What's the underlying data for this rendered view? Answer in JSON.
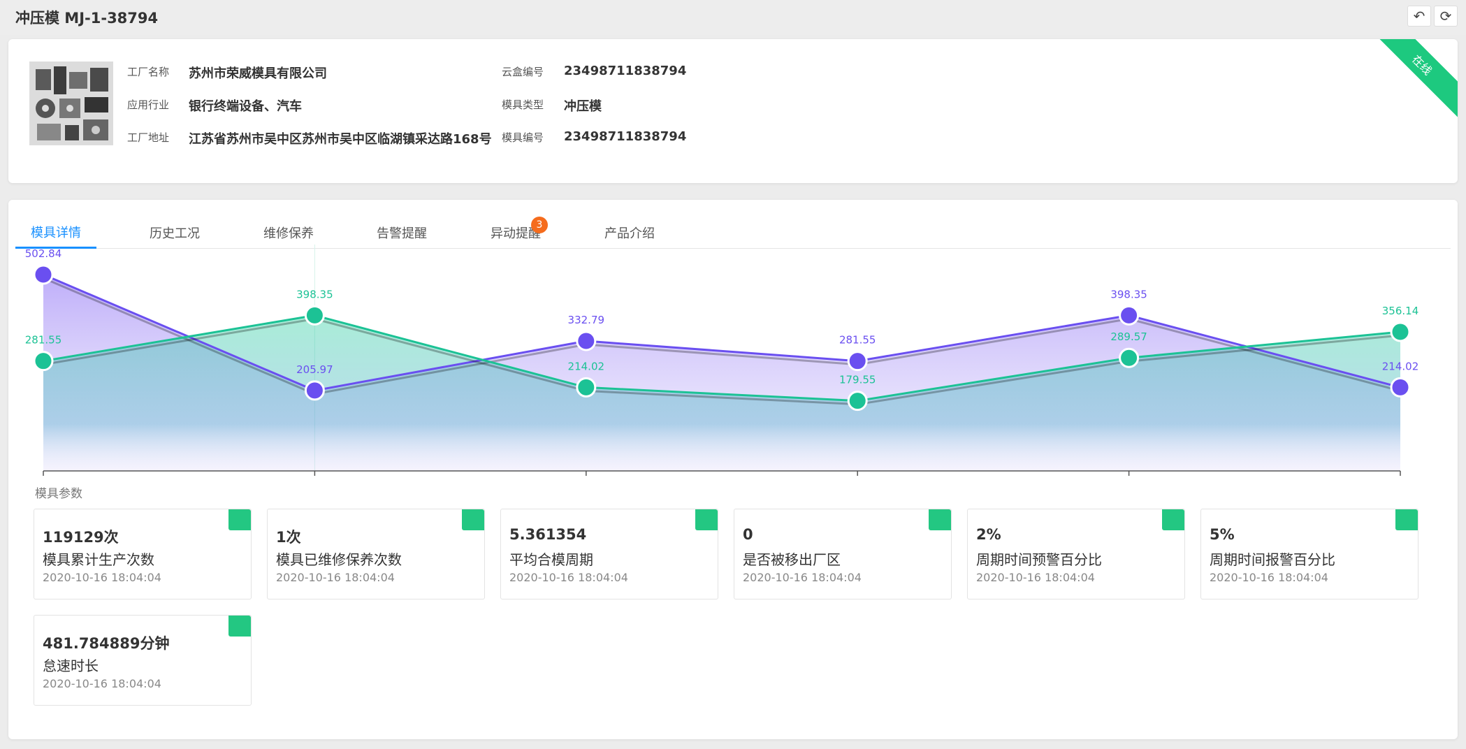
{
  "header": {
    "title": "冲压模 MJ-1-38794",
    "back_icon": "undo-icon",
    "refresh_icon": "refresh-icon"
  },
  "info": {
    "factory_name_label": "工厂名称",
    "factory_name": "苏州市荣威模具有限公司",
    "industry_label": "应用行业",
    "industry": "银行终端设备、汽车",
    "address_label": "工厂地址",
    "address": "江苏省苏州市吴中区苏州市吴中区临湖镇采达路168号",
    "box_no_label": "云盒编号",
    "box_no": "23498711838794",
    "mold_type_label": "模具类型",
    "mold_type": "冲压模",
    "mold_no_label": "模具编号",
    "mold_no": "23498711838794",
    "status": "在线",
    "status_color": "#1dc97f"
  },
  "tabs": [
    {
      "label": "模具详情",
      "active": true
    },
    {
      "label": "历史工况"
    },
    {
      "label": "维修保养"
    },
    {
      "label": "告警提醒"
    },
    {
      "label": "异动提醒",
      "badge": "3"
    },
    {
      "label": "产品介绍"
    }
  ],
  "chart_data": {
    "type": "area",
    "x": [
      "",
      "",
      "",
      "",
      "",
      ""
    ],
    "series": [
      {
        "color": "#6a4ff0",
        "values": [
          502.84,
          205.97,
          332.79,
          281.55,
          398.35,
          214.02
        ]
      },
      {
        "color": "#1cc295",
        "values": [
          281.55,
          398.35,
          214.02,
          179.55,
          289.57,
          356.14
        ]
      }
    ],
    "ylim": [
      0,
      560
    ],
    "xlabel": "",
    "ylabel": "",
    "grid": false
  },
  "params_section_label": "模具参数",
  "params": [
    {
      "value": "119129次",
      "name": "模具累计生产次数",
      "time": "2020-10-16 18:04:04"
    },
    {
      "value": "1次",
      "name": "模具已维修保养次数",
      "time": "2020-10-16 18:04:04"
    },
    {
      "value": "5.361354",
      "name": "平均合模周期",
      "time": "2020-10-16 18:04:04"
    },
    {
      "value": "0",
      "name": "是否被移出厂区",
      "time": "2020-10-16 18:04:04"
    },
    {
      "value": "2%",
      "name": "周期时间预警百分比",
      "time": "2020-10-16 18:04:04"
    },
    {
      "value": "5%",
      "name": "周期时间报警百分比",
      "time": "2020-10-16 18:04:04"
    },
    {
      "value": "481.784889分钟",
      "name": "怠速时长",
      "time": "2020-10-16 18:04:04"
    }
  ],
  "colors": {
    "accent": "#1890ff",
    "flag": "#23c782",
    "badge": "#f56c1d"
  }
}
